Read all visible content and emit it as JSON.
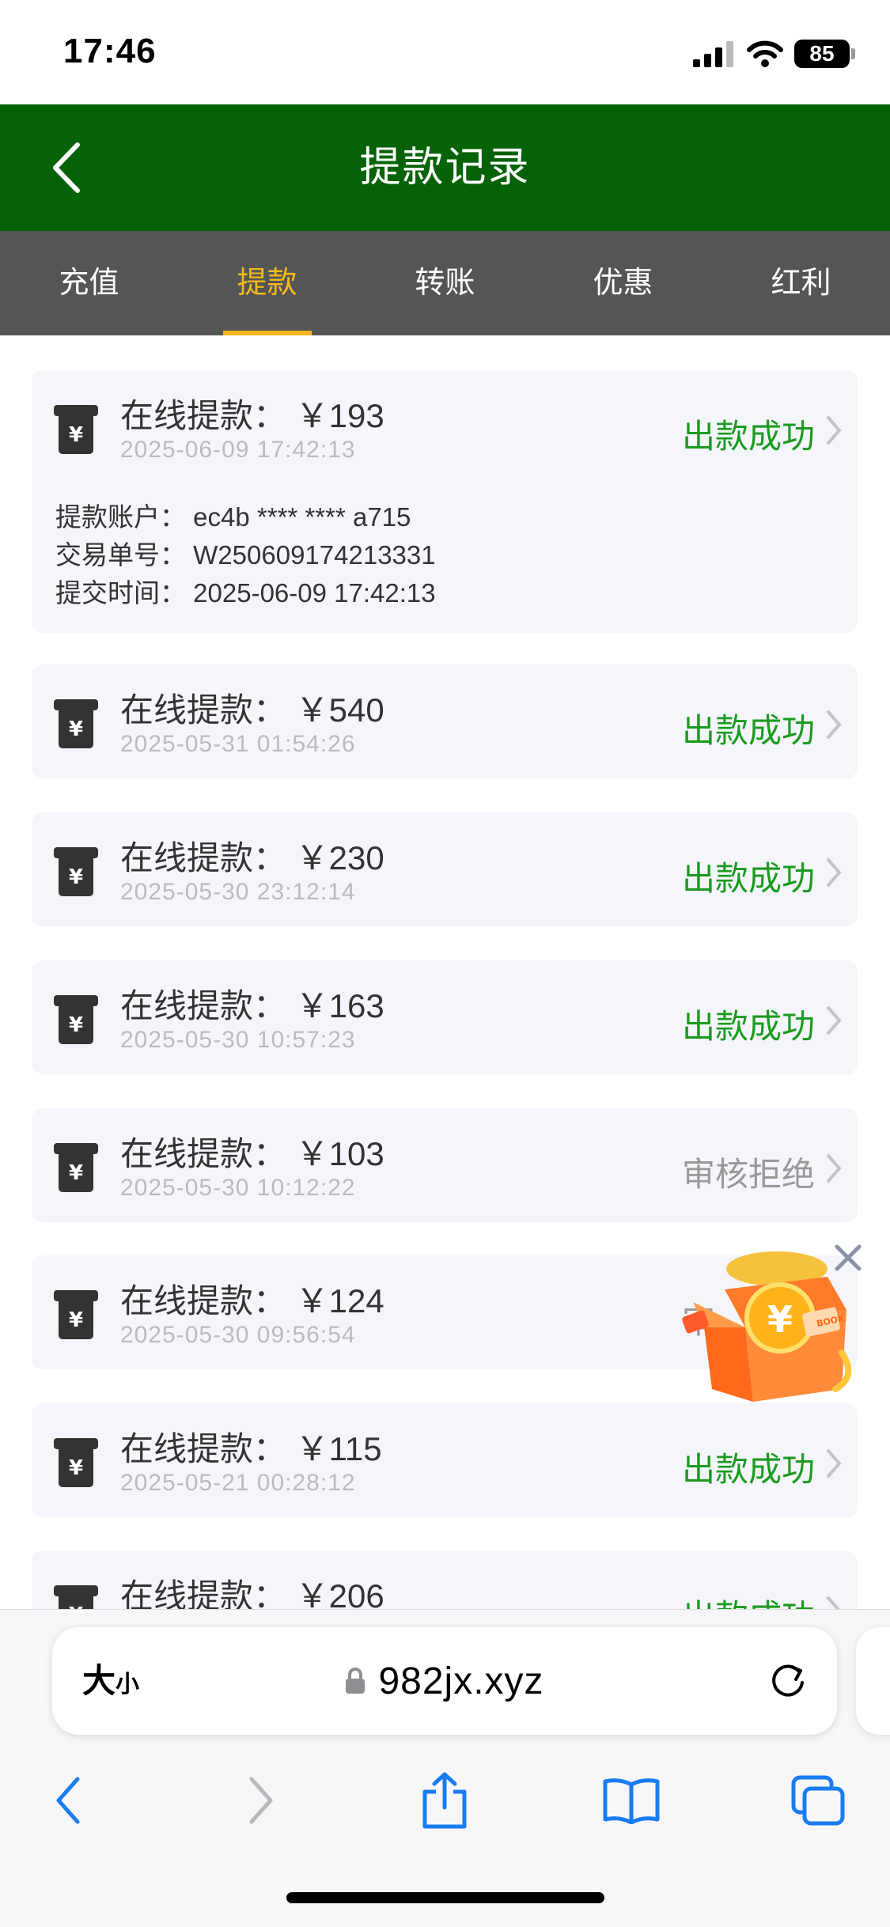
{
  "status_bar": {
    "time": "17:46",
    "battery": "85"
  },
  "header": {
    "title": "提款记录"
  },
  "tabs": [
    {
      "label": "充值",
      "active": false
    },
    {
      "label": "提款",
      "active": true
    },
    {
      "label": "转账",
      "active": false
    },
    {
      "label": "优惠",
      "active": false
    },
    {
      "label": "红利",
      "active": false
    }
  ],
  "records": [
    {
      "title": "在线提款： ￥193",
      "date": "2025-06-09 17:42:13",
      "status": "出款成功",
      "details": [
        "提款账户：  ec4b **** **** a715",
        "交易单号：  W250609174213331",
        "提交时间：  2025-06-09 17:42:13"
      ]
    },
    {
      "title": "在线提款： ￥540",
      "date": "2025-05-31 01:54:26",
      "status": "出款成功"
    },
    {
      "title": "在线提款： ￥230",
      "date": "2025-05-30 23:12:14",
      "status": "出款成功"
    },
    {
      "title": "在线提款： ￥163",
      "date": "2025-05-30 10:57:23",
      "status": "出款成功"
    },
    {
      "title": "在线提款： ￥103",
      "date": "2025-05-30 10:12:22",
      "status": "审核拒绝"
    },
    {
      "title": "在线提款： ￥124",
      "date": "2025-05-30 09:56:54",
      "status": "审"
    },
    {
      "title": "在线提款： ￥115",
      "date": "2025-05-21 00:28:12",
      "status": "出款成功"
    },
    {
      "title": "在线提款： ￥206",
      "date": "",
      "status": "出款成功"
    }
  ],
  "browser": {
    "text_size_big": "大",
    "text_size_small": "小",
    "url": "982jx.xyz"
  },
  "colors": {
    "header_green": "#056207",
    "tab_active": "#f2b81c",
    "success": "#1b9a1f",
    "rejected": "#999999"
  },
  "icons": [
    "back-arrow-icon",
    "withdraw-atm-icon",
    "chevron-right-icon",
    "gift-box-promo-icon",
    "close-icon",
    "lock-icon",
    "reload-icon",
    "share-icon",
    "bookmarks-icon",
    "tabs-icon"
  ]
}
